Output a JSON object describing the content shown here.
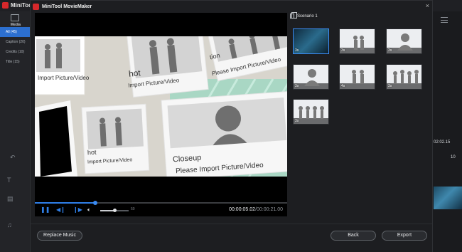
{
  "background_app": {
    "logo": "MiniTool",
    "media_tab": "Media",
    "sidebar": [
      "All (45)",
      "Caption (20)",
      "Credits (10)",
      "Title (15)"
    ],
    "time": "02:02.15",
    "zoom": "10"
  },
  "dialog": {
    "title": "MiniTool MovieMaker",
    "close": "×"
  },
  "preview": {
    "cards": [
      {
        "label": "Import Picture/Video",
        "heading": ""
      },
      {
        "label": "Import Picture/Video",
        "heading": "hot"
      },
      {
        "label": "Please Import Picture/Video",
        "heading": "tion"
      },
      {
        "label": "Import Picture/Video",
        "heading": "hot"
      },
      {
        "label": "Please Import Picture/Video",
        "heading": "Closeup"
      }
    ]
  },
  "playback": {
    "progress": 0.24,
    "volume": 0.5,
    "volume_value": "50",
    "current_time": "00:00:05.02",
    "total_time": "/00:00:21.00"
  },
  "scenario": {
    "label": "Scenario 1",
    "thumbnails": [
      {
        "duration": "3s",
        "selected": true
      },
      {
        "duration": "3s",
        "selected": false
      },
      {
        "duration": "3s",
        "selected": false
      },
      {
        "duration": "3s",
        "selected": false
      },
      {
        "duration": "4s",
        "selected": false
      },
      {
        "duration": "3s",
        "selected": false
      },
      {
        "duration": "3s",
        "selected": false
      }
    ]
  },
  "footer": {
    "replace_music": "Replace Music",
    "back": "Back",
    "export": "Export"
  },
  "colors": {
    "accent": "#2f7fe8",
    "brand": "#d6282b"
  }
}
